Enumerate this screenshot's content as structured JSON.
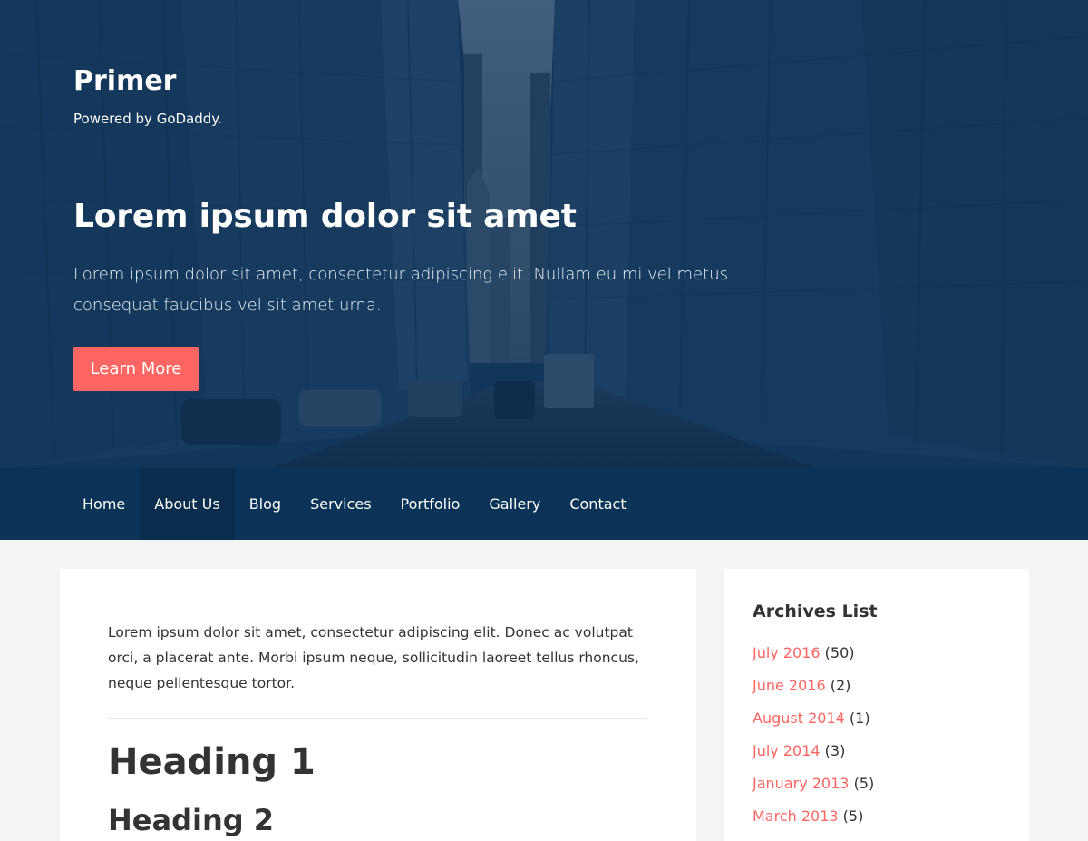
{
  "colors": {
    "accent": "#ff6663",
    "hero_overlay": "#13375a",
    "nav_bg": "#0b3358",
    "nav_active_bg": "#0a2c4d",
    "page_bg": "#f4f4f4",
    "card_bg": "#ffffff"
  },
  "header": {
    "site_title": "Primer",
    "tagline": "Powered by GoDaddy."
  },
  "hero": {
    "heading": "Lorem ipsum dolor sit amet",
    "text": "Lorem ipsum dolor sit amet, consectetur adipiscing elit. Nullam eu mi vel metus consequat faucibus vel sit amet urna.",
    "button_label": "Learn More"
  },
  "nav": {
    "items": [
      {
        "label": "Home",
        "active": false
      },
      {
        "label": "About Us",
        "active": true
      },
      {
        "label": "Blog",
        "active": false
      },
      {
        "label": "Services",
        "active": false
      },
      {
        "label": "Portfolio",
        "active": false
      },
      {
        "label": "Gallery",
        "active": false
      },
      {
        "label": "Contact",
        "active": false
      }
    ]
  },
  "main": {
    "intro": "Lorem ipsum dolor sit amet, consectetur adipiscing elit. Donec ac volutpat orci, a placerat ante. Morbi ipsum neque, sollicitudin laoreet tellus rhoncus, neque pellentesque tortor.",
    "heading_1": "Heading 1",
    "heading_2": "Heading 2"
  },
  "sidebar": {
    "widget_title": "Archives List",
    "archives": [
      {
        "label": "July 2016",
        "count": "(50)"
      },
      {
        "label": "June 2016",
        "count": "(2)"
      },
      {
        "label": "August 2014",
        "count": "(1)"
      },
      {
        "label": "July 2014",
        "count": "(3)"
      },
      {
        "label": "January 2013",
        "count": "(5)"
      },
      {
        "label": "March 2013",
        "count": "(5)"
      }
    ]
  }
}
